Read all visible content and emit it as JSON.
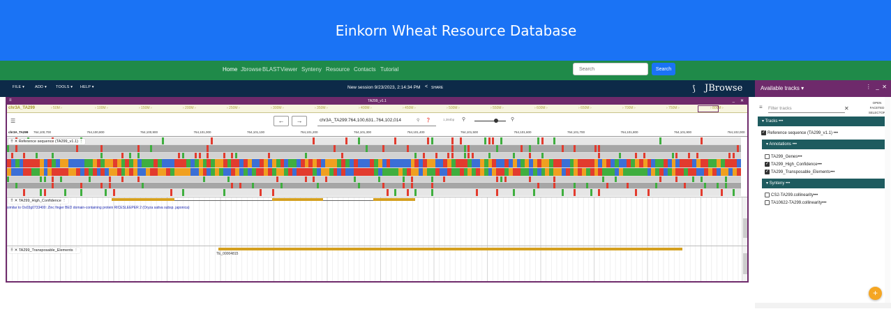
{
  "banner": {
    "title": "Einkorn Wheat Resource Database"
  },
  "nav": {
    "links": [
      "Home",
      "Jbrowse",
      "BLAST",
      "Viewer",
      "Synteny",
      "Resource",
      "Contacts",
      "Tutorial"
    ],
    "search_placeholder": "Search",
    "search_button": "Search"
  },
  "jbrowse": {
    "menus": [
      "FILE ▾",
      "ADD ▾",
      "TOOLS ▾",
      "HELP ▾"
    ],
    "session": "New session 9/23/2023, 2:14:34 PM",
    "share": "SHARE",
    "logo": "JBrowse"
  },
  "view": {
    "title": "TA299_v1.1",
    "overview_chr": "chr3A_TA299",
    "overview_ticks": [
      "50M",
      "100M",
      "150M",
      "200M",
      "250M",
      "300M",
      "350M",
      "400M",
      "450M",
      "500M",
      "550M",
      "600M",
      "650M",
      "700M",
      "750M",
      "800M"
    ],
    "locstring": "chr3A_TA299:764,100,631..764,102,014",
    "bp_label": "1,384bp",
    "scale_chr": "chr3A_TA299",
    "scale_ticks": [
      "764,100,700",
      "764,100,800",
      "764,100,900",
      "764,101,000",
      "764,101,100",
      "764,101,200",
      "764,101,300",
      "764,101,400",
      "764,101,500",
      "764,101,600",
      "764,101,700",
      "764,101,800",
      "764,101,900",
      "764,102,000"
    ],
    "tracks": {
      "ref": "Reference sequence (TA299_v1.1)",
      "hc": "TA299_High_Confidence",
      "hc_desc": "similar to Os03g0733400: Zinc finger BED domain-containing protein RICESLEEPER 2 (Oryza sativa subsp. japonica)",
      "te": "TA299_Transposable_Elements",
      "te_feature": "TE_00004815"
    }
  },
  "sidebar": {
    "title": "Available tracks ▾",
    "filter_placeholder": "Filter tracks",
    "faceted": "OPEN FACETED SELECTOR",
    "tracks_cat": "▾ Tracks •••",
    "ref_item": "Reference sequence (TA299_v1.1)",
    "annotations_cat": "▾ Annotations •••",
    "annotation_items": [
      {
        "label": "TA299_Genes",
        "checked": false
      },
      {
        "label": "TA299_High_Confidence",
        "checked": true
      },
      {
        "label": "TA299_Transposable_Elements",
        "checked": true
      }
    ],
    "synteny_cat": "▾ Synteny •••",
    "synteny_items": [
      {
        "label": "CS2-TA299.collinearity",
        "checked": false
      },
      {
        "label": "TA10622-TA299.collinearity",
        "checked": false
      }
    ]
  },
  "colors": {
    "banner": "#1a73f5",
    "nav": "#1f8a49",
    "jbrowse_bar": "#0d2a48",
    "accent": "#6e2a6b",
    "category": "#1e5b5f",
    "feature": "#d4a020",
    "fab": "#f5a623"
  }
}
